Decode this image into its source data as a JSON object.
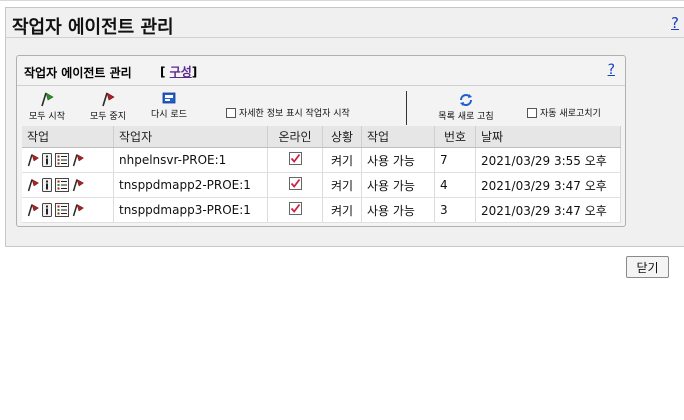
{
  "page": {
    "title": "작업자 에이전트 관리",
    "help": "?"
  },
  "panel": {
    "title": "작업자 에이전트 관리",
    "config_open": "[",
    "config_link": "구성",
    "config_close": "]",
    "help": "?"
  },
  "toolbar": {
    "start_all": "모두 시작",
    "stop_all": "모두 중지",
    "reload": "다시 로드",
    "show_details": "자세한 정보 표시 작업자 시작",
    "refresh_list": "목록 새로 고침",
    "auto_refresh": "자동 새로고치기"
  },
  "table": {
    "headers": [
      "작업",
      "작업자",
      "온라인",
      "상황",
      "작업",
      "번호",
      "날짜"
    ],
    "rows": [
      {
        "worker": "nhpelnsvr-PROE:1",
        "online": true,
        "status": "켜기",
        "job": "사용 가능",
        "number": "7",
        "date": "2021/03/29 3:55 오후"
      },
      {
        "worker": "tnsppdmapp2-PROE:1",
        "online": true,
        "status": "켜기",
        "job": "사용 가능",
        "number": "4",
        "date": "2021/03/29 3:47 오후"
      },
      {
        "worker": "tnsppdmapp3-PROE:1",
        "online": true,
        "status": "켜기",
        "job": "사용 가능",
        "number": "3",
        "date": "2021/03/29 3:47 오후"
      }
    ]
  },
  "footer": {
    "close": "닫기"
  },
  "colors": {
    "flag_red": "#b02020",
    "flag_green": "#2e8b2e",
    "check_red": "#d02040",
    "link_blue": "#1a3fbf",
    "link_purple": "#5b2a8c"
  },
  "icons": {
    "start_all": "green-flag-icon",
    "stop_all": "red-flag-icon",
    "reload": "reload-icon",
    "refresh_list": "refresh-arrows-icon",
    "row_actions": [
      "start-flag-icon",
      "info-icon",
      "details-list-icon",
      "stop-flag-icon"
    ]
  }
}
